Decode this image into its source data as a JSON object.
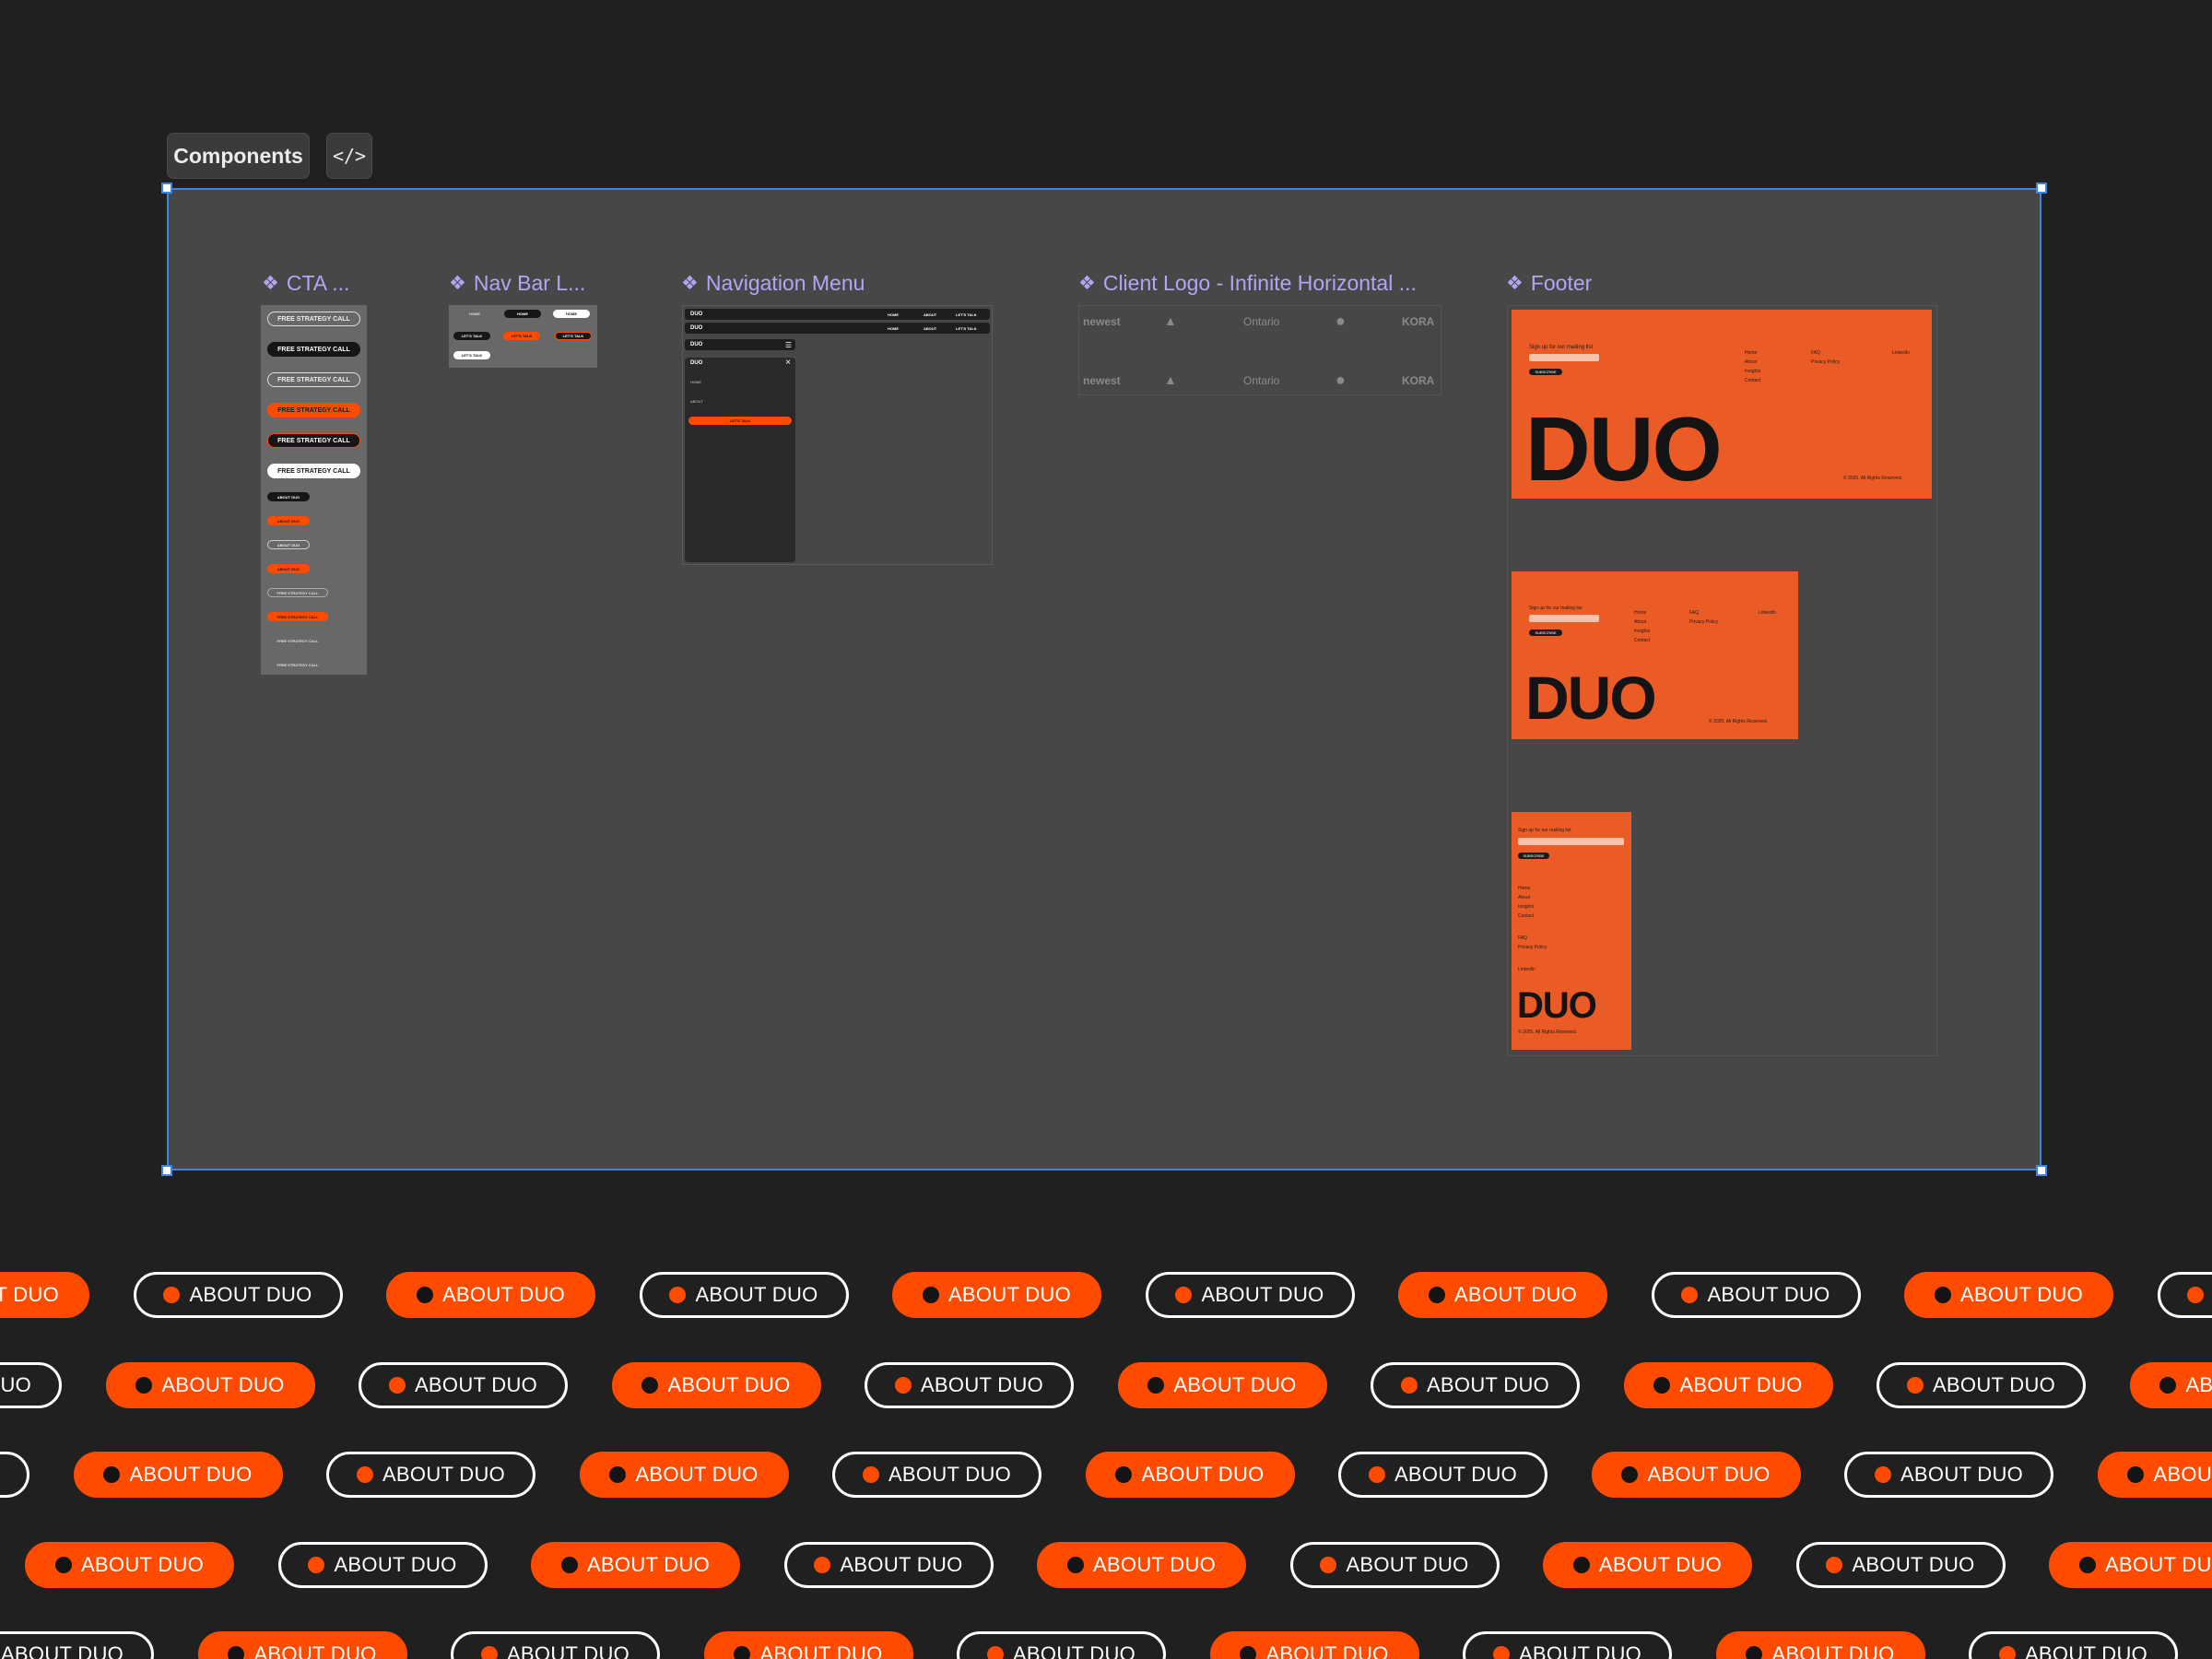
{
  "toolbar": {
    "components_label": "Components",
    "code_label": "</>"
  },
  "components": [
    {
      "label": "CTA ..."
    },
    {
      "label": "Nav Bar L..."
    },
    {
      "label": "Navigation Menu"
    },
    {
      "label": "Client Logo - Infinite Horizontal ..."
    },
    {
      "label": "Footer"
    }
  ],
  "cta": {
    "free_call": "FREE STRATEGY CALL",
    "about": "ABOUT DUO"
  },
  "navbar": {
    "home": "HOME",
    "lets_talk": "LET'S TALK"
  },
  "navmenu": {
    "brand": "DUO",
    "home": "HOME",
    "about": "ABOUT",
    "lets_talk": "LET'S TALK",
    "close": "×"
  },
  "logos": {
    "newest": "newest",
    "kora": "KORA",
    "ontario": "Ontario"
  },
  "footer": {
    "signup": "Sign up for our mailing list",
    "subscribe": "SUBSCRIBE",
    "menu_items": [
      "Home",
      "About",
      "Insights",
      "Contact"
    ],
    "support_items": [
      "FAQ",
      "Privacy Policy"
    ],
    "social": "LinkedIn",
    "brand": "DUO",
    "copyright": "© 2025. All Rights Reserved."
  },
  "pills": {
    "label": "ABOUT DUO"
  },
  "colors": {
    "accent": "#ff4b00",
    "footer_orange": "#ea5b26",
    "selection_blue": "#3d85e0",
    "label_purple": "#b5a4f4"
  }
}
